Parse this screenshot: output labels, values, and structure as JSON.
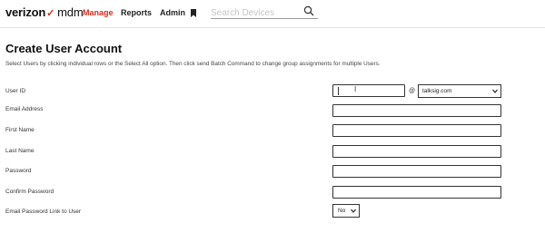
{
  "brand": {
    "logo_text": "verizon",
    "logo_check": "✓",
    "product": "mdm",
    "accent": "#d52b1e"
  },
  "nav": {
    "manage": "Manage",
    "reports": "Reports",
    "admin": "Admin"
  },
  "search": {
    "placeholder": "Search Devices",
    "icon": "search-icon"
  },
  "page": {
    "title": "Create User Account",
    "instructions": "Select Users by clicking individual rows or the Select All option. Then click send Batch Command to change group assignments for multiple Users."
  },
  "form": {
    "user_id_label": "User ID",
    "user_id_value": "",
    "at_sign": "@",
    "domain_selected": "talksig.com",
    "email_label": "Email Address",
    "first_name_label": "First Name",
    "last_name_label": "Last Name",
    "password_label": "Password",
    "confirm_password_label": "Confirm Password",
    "email_link_label": "Email Password Link to User",
    "email_link_selected": "No"
  }
}
